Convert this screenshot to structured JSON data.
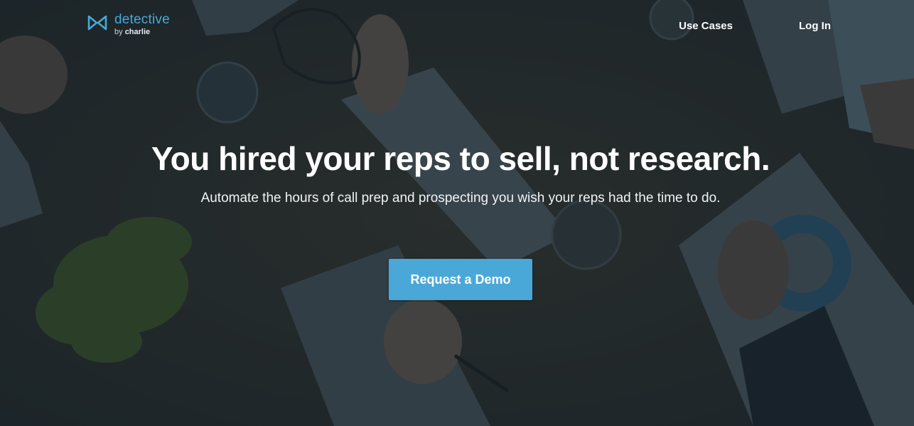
{
  "brand": {
    "name": "detective",
    "by_prefix": "by",
    "by_name": "charlie",
    "accent_color": "#46a9d8"
  },
  "nav": {
    "items": [
      {
        "label": "Use Cases"
      },
      {
        "label": "Log In"
      }
    ]
  },
  "hero": {
    "headline": "You hired your reps to sell, not research.",
    "subheadline": "Automate the hours of call prep and prospecting you wish your reps had the time to do.",
    "cta_label": "Request a Demo",
    "cta_color": "#4aa8d8"
  },
  "background": {
    "description_icon": "desk-meeting-photo"
  }
}
